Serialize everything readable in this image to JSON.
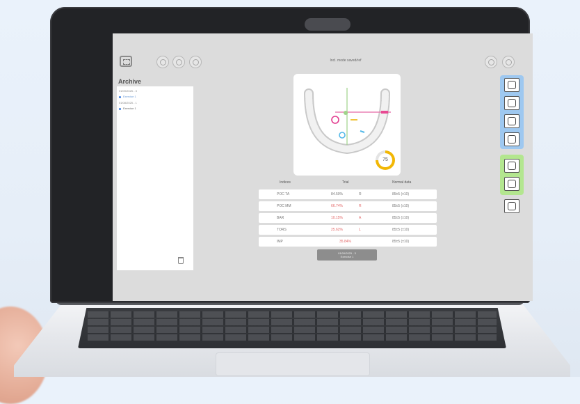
{
  "header": {
    "title": "Incl. mode saved/ref",
    "left_icons": [
      "fit-screen-icon",
      "home-icon",
      "refresh-icon",
      "settings-icon"
    ],
    "right_icons": [
      "help-icon",
      "info-icon"
    ]
  },
  "archive": {
    "label": "Archive",
    "entries": [
      {
        "text": "01/09/2025 - 3",
        "type": "group"
      },
      {
        "text": "Exercise 1",
        "type": "item"
      },
      {
        "text": "01/08/2025 - 1",
        "type": "group"
      },
      {
        "text": "Exercise 1",
        "type": "item"
      }
    ]
  },
  "chart": {
    "score": "75",
    "score_color": "#f2b705"
  },
  "table": {
    "headers": [
      "Indices",
      "Trial",
      "Normal data"
    ],
    "rows": [
      {
        "index": "POC TA",
        "value": "84.50%",
        "side": "R",
        "normal": "85±5 (±10)",
        "alert": false
      },
      {
        "index": "POC MM",
        "value": "66.74%",
        "side": "R",
        "normal": "85±5 (±10)",
        "alert": true
      },
      {
        "index": "BAR",
        "value": "10.15%",
        "side": "A",
        "normal": "85±5 (±10)",
        "alert": true
      },
      {
        "index": "TORS",
        "value": "25.62%",
        "side": "L",
        "normal": "85±5 (±10)",
        "alert": true
      },
      {
        "index": "IMP",
        "value": "35.84%",
        "side": "",
        "normal": "85±5 (±10)",
        "alert": true
      }
    ]
  },
  "action_button": {
    "line1": "01/09/2025 - 3",
    "line2": "Exercise 1"
  },
  "colors": {
    "accent_blue": "#6fa9e6",
    "accent_green": "#8fd86a",
    "alert_red": "#e36a6a",
    "score_yellow": "#f2b705"
  }
}
